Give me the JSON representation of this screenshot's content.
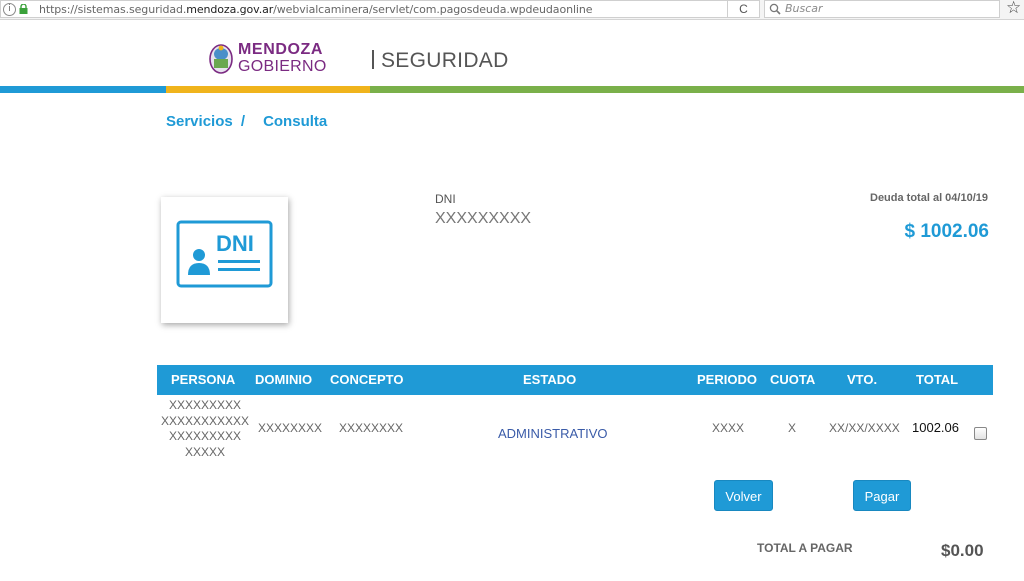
{
  "browser": {
    "url_prefix": "https://sistemas.seguridad.",
    "url_domain": "mendoza.gov.ar",
    "url_path": "/webvialcaminera/servlet/com.pagosdeuda.wpdeudaonline",
    "search_placeholder": "Buscar",
    "info_glyph": "i",
    "reload_glyph": "C",
    "star_glyph": "☆"
  },
  "header": {
    "logo_line1": "MENDOZA",
    "logo_line2": "GOBIERNO",
    "title": "SEGURIDAD"
  },
  "breadcrumb": {
    "item1": "Servicios",
    "separator": "/",
    "item2": "Consulta"
  },
  "dni_card": {
    "icon_text": "DNI"
  },
  "person": {
    "dni_label": "DNI",
    "dni_value": "XXXXXXXXX"
  },
  "debt": {
    "label": "Deuda total al 04/10/19",
    "value": "$ 1002.06"
  },
  "table": {
    "headers": {
      "persona": "PERSONA",
      "dominio": "DOMINIO",
      "concepto": "CONCEPTO",
      "estado": "ESTADO",
      "periodo": "PERIODO",
      "cuota": "CUOTA",
      "vto": "VTO.",
      "total": "TOTAL"
    },
    "row": {
      "persona": [
        "XXXXXXXXX",
        "XXXXXXXXXXX",
        "XXXXXXXXX",
        "XXXXX"
      ],
      "dominio": "XXXXXXXX",
      "concepto": "XXXXXXXX",
      "estado": "ADMINISTRATIVO",
      "periodo": "XXXX",
      "cuota": "X",
      "vto": "XX/XX/XXXX",
      "total": "1002.06",
      "selected": false
    }
  },
  "actions": {
    "volver": "Volver",
    "pagar": "Pagar"
  },
  "summary": {
    "total_label": "TOTAL A PAGAR",
    "total_value": "$0.00"
  },
  "colors": {
    "primary": "#1f9ad6",
    "brand_purple": "#7b2b82",
    "stripe_blue": "#1f9ad6",
    "stripe_yellow": "#f0b41c",
    "stripe_green": "#7ab04a",
    "link_blue": "#3a5ba8"
  }
}
